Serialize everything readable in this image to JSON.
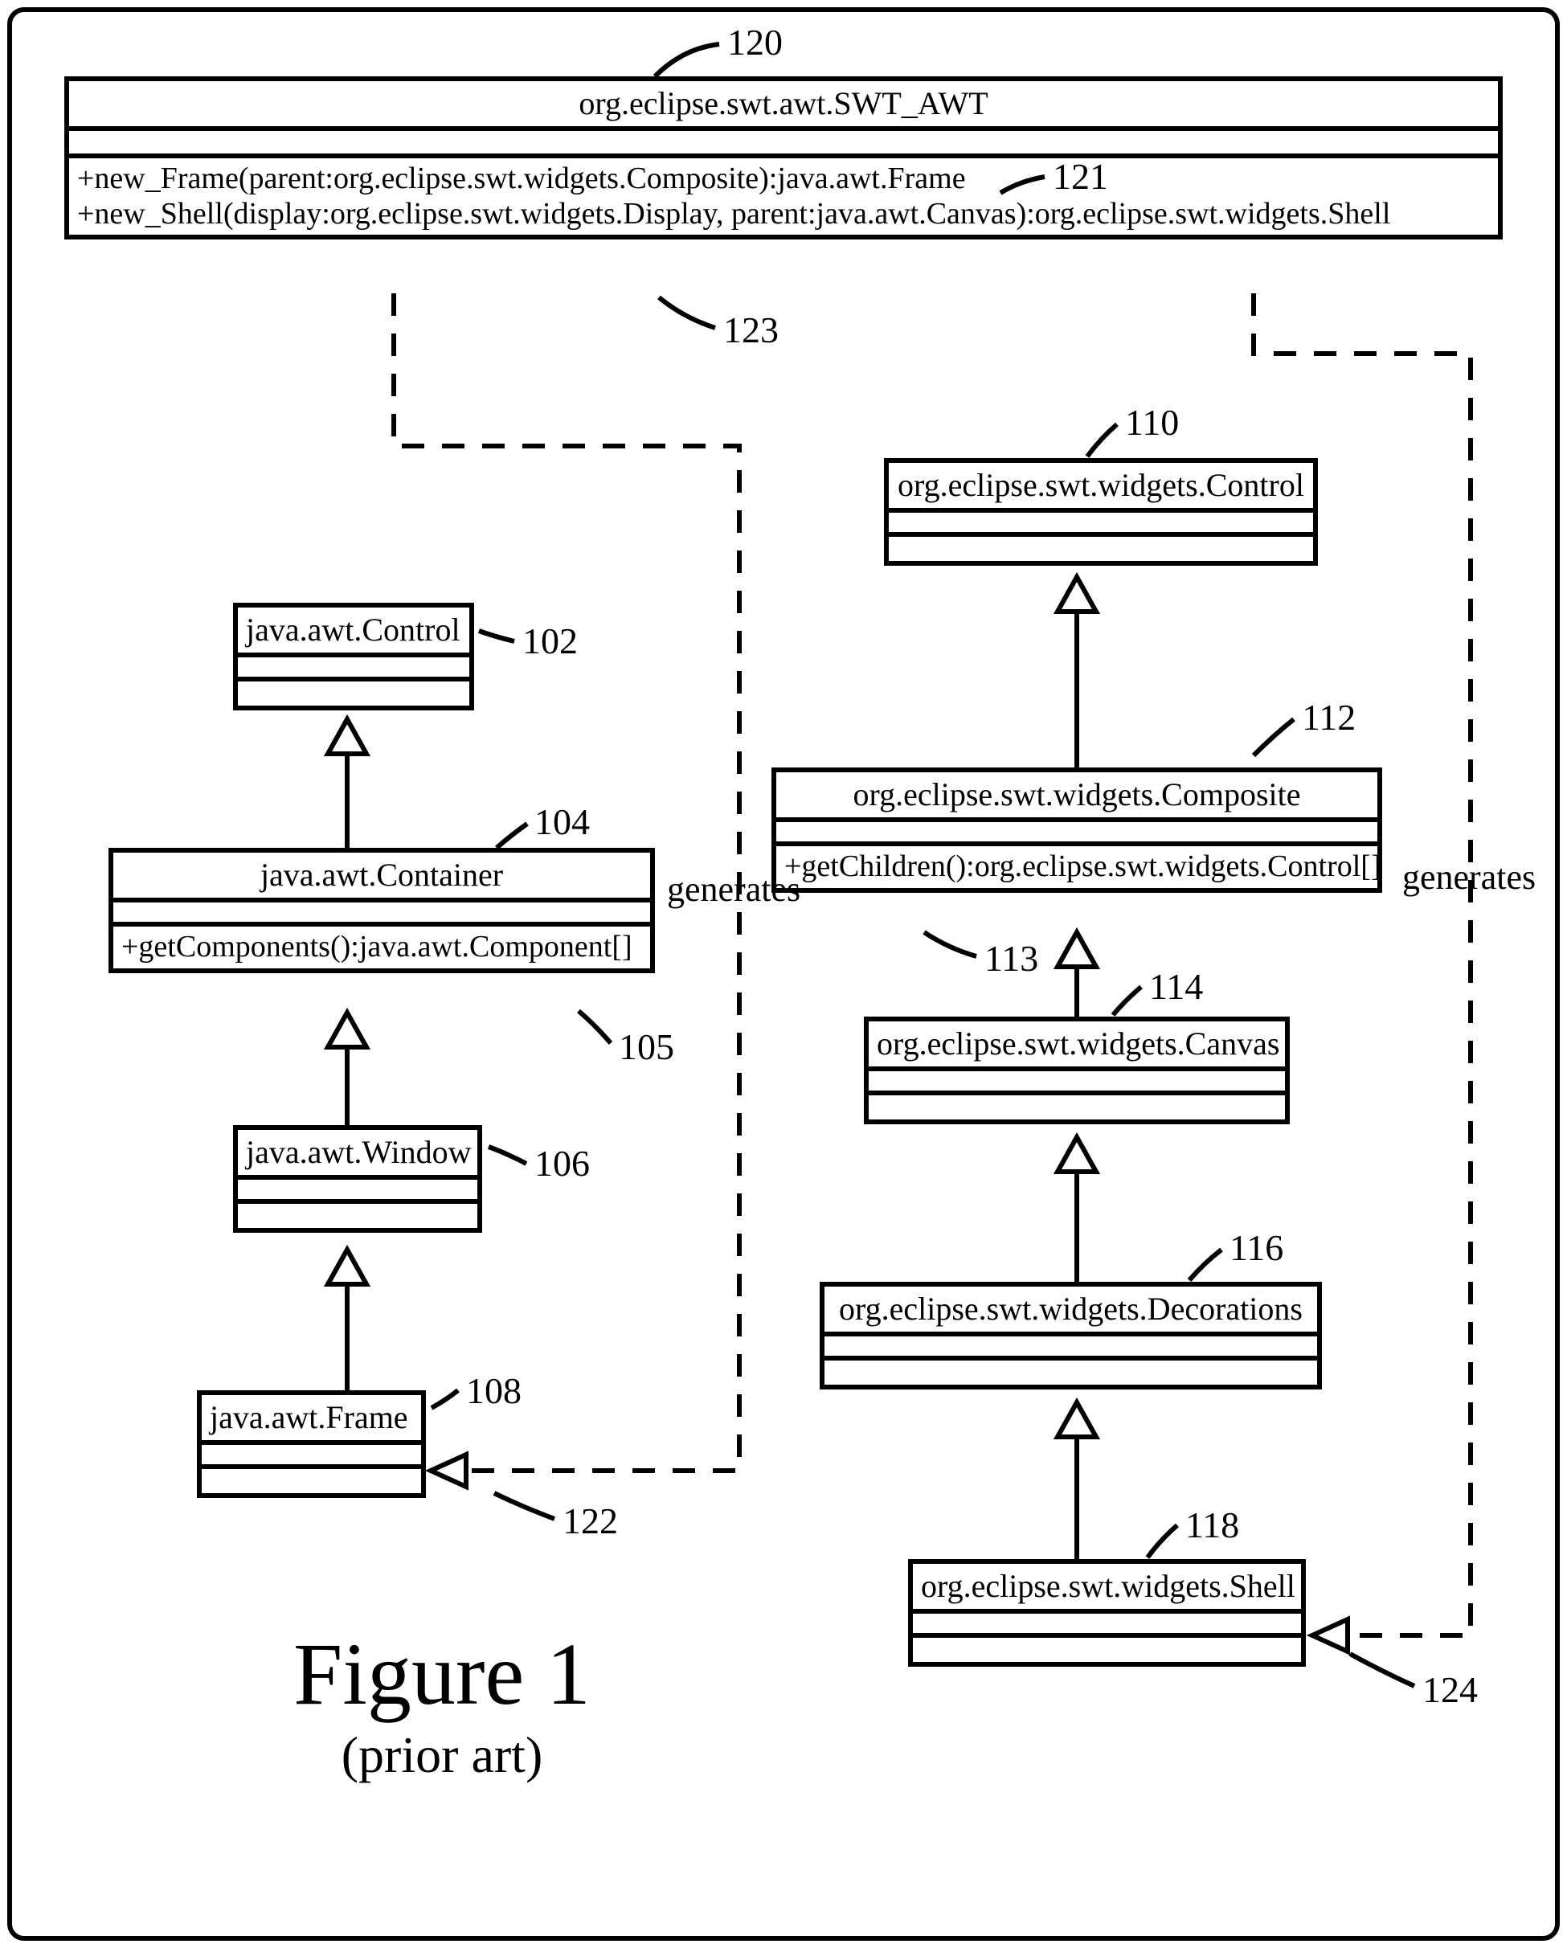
{
  "figure": {
    "title": "Figure 1",
    "subtitle": "(prior art)"
  },
  "callouts": {
    "c120": "120",
    "c121": "121",
    "c123": "123",
    "c102": "102",
    "c104": "104",
    "c105": "105",
    "c106": "106",
    "c108": "108",
    "c110": "110",
    "c112": "112",
    "c113": "113",
    "c114": "114",
    "c116": "116",
    "c118": "118",
    "c122": "122",
    "c124": "124"
  },
  "labels": {
    "generates_left": "generates",
    "generates_right": "generates"
  },
  "classes": {
    "swtawt": {
      "name": "org.eclipse.swt.awt.SWT_AWT",
      "ops1": "+new_Frame(parent:org.eclipse.swt.widgets.Composite):java.awt.Frame",
      "ops2": "+new_Shell(display:org.eclipse.swt.widgets.Display, parent:java.awt.Canvas):org.eclipse.swt.widgets.Shell"
    },
    "awtControl": {
      "name": "java.awt.Control"
    },
    "awtContainer": {
      "name": "java.awt.Container",
      "ops1": "+getComponents():java.awt.Component[]"
    },
    "awtWindow": {
      "name": "java.awt.Window"
    },
    "awtFrame": {
      "name": "java.awt.Frame"
    },
    "swtControl": {
      "name": "org.eclipse.swt.widgets.Control"
    },
    "swtComposite": {
      "name": "org.eclipse.swt.widgets.Composite",
      "ops1": "+getChildren():org.eclipse.swt.widgets.Control[]"
    },
    "swtCanvas": {
      "name": "org.eclipse.swt.widgets.Canvas"
    },
    "swtDecorations": {
      "name": "org.eclipse.swt.widgets.Decorations"
    },
    "swtShell": {
      "name": "org.eclipse.swt.widgets.Shell"
    }
  }
}
